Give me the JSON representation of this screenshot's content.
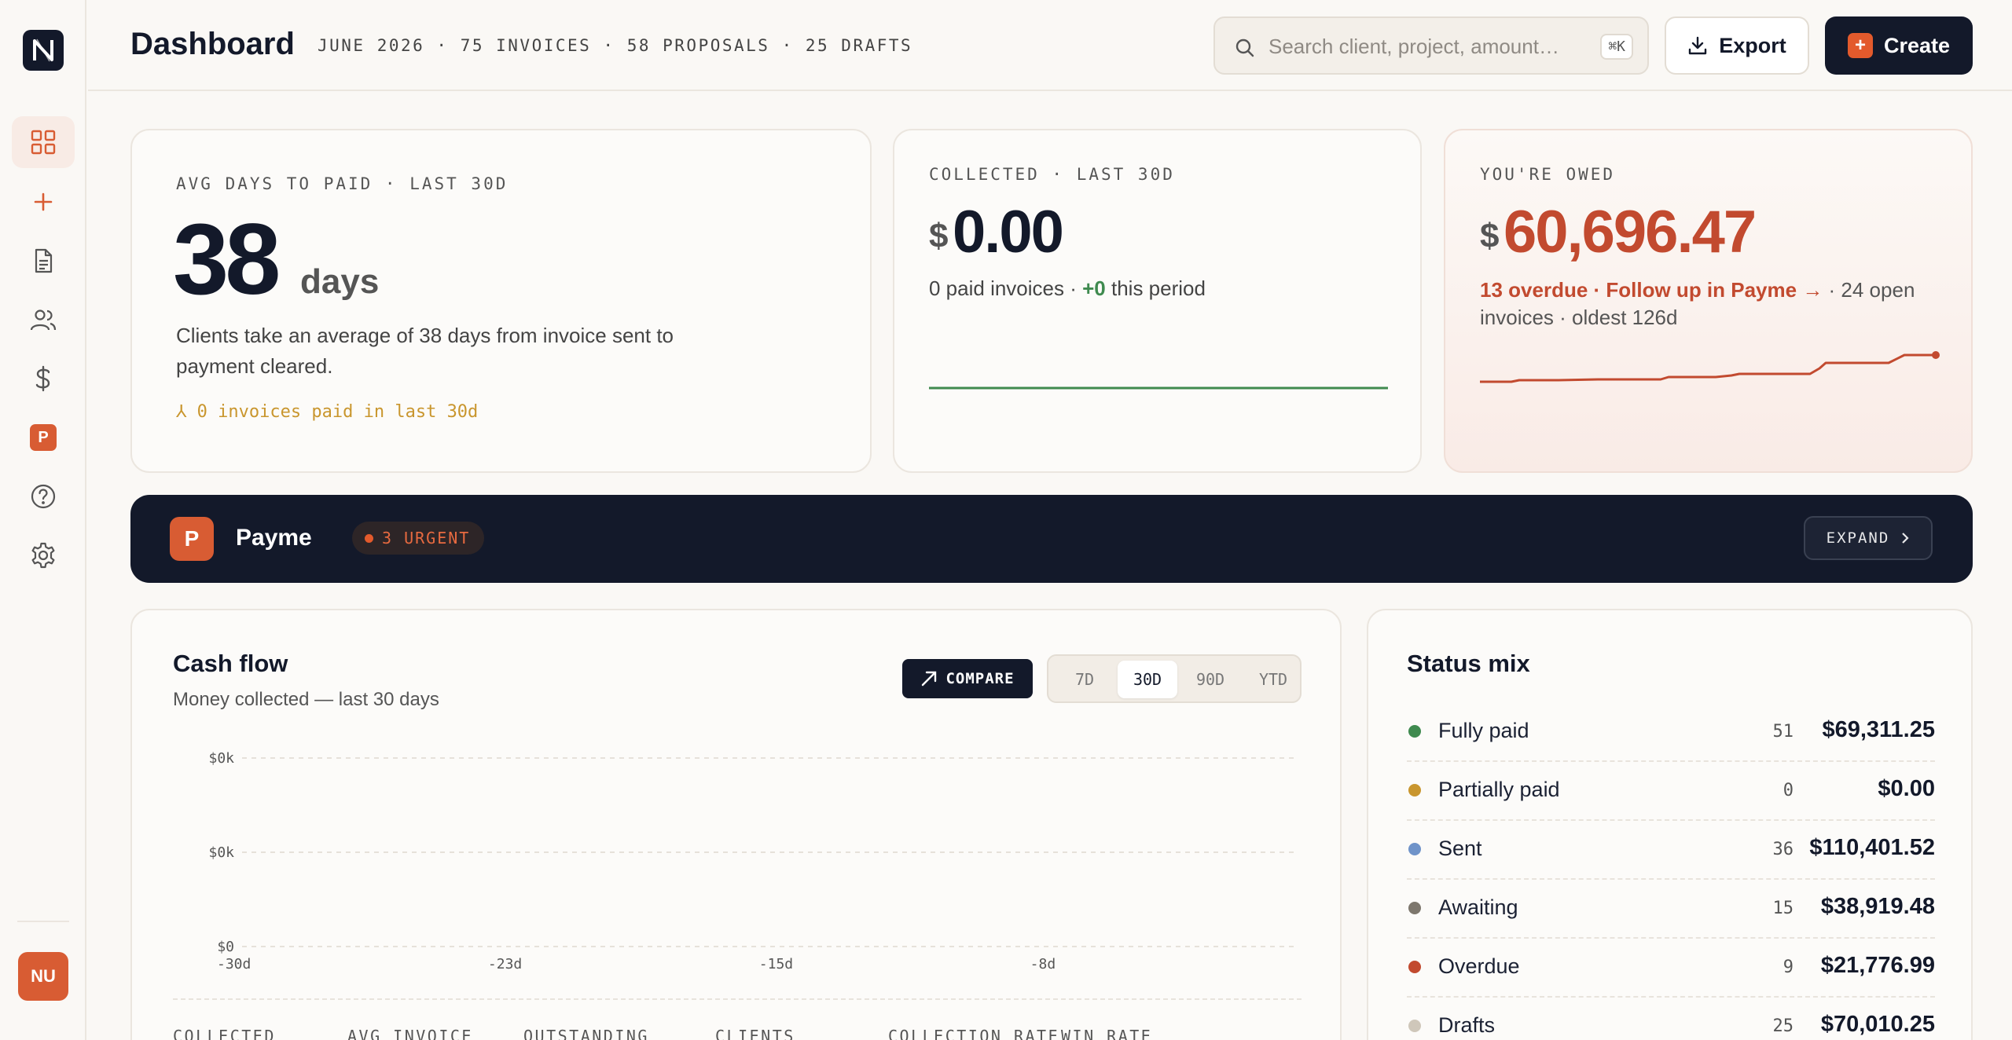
{
  "app": {
    "logo_letter": "N",
    "avatar_initials": "NU",
    "sidebar_p_badge": "P"
  },
  "header": {
    "title": "Dashboard",
    "subtitle": "JUNE 2026 · 75 INVOICES · 58 PROPOSALS · 25 DRAFTS",
    "search_placeholder": "Search client, project, amount…",
    "search_shortcut": "⌘K",
    "export_label": "Export",
    "create_label": "Create"
  },
  "cards": {
    "avg_days": {
      "label": "AVG DAYS TO PAID · LAST 30D",
      "value": "38",
      "unit": "days",
      "description": "Clients take an average of 38 days from invoice sent to payment cleared.",
      "note": "⅄ 0 invoices paid in last 30d"
    },
    "collected": {
      "label": "COLLECTED · LAST 30D",
      "currency": "$",
      "value": "0.00",
      "detail_prefix": "0 paid invoices · ",
      "detail_delta": "+0",
      "detail_suffix": " this period"
    },
    "owed": {
      "label": "YOU'RE OWED",
      "currency": "$",
      "value": "60,696.47",
      "alert": "13 overdue · Follow up in Payme →",
      "detail": " · 24 open invoices · oldest 126d"
    }
  },
  "payme": {
    "badge_letter": "P",
    "name": "Payme",
    "urgent_label": "3 URGENT",
    "expand_label": "EXPAND"
  },
  "cashflow": {
    "title": "Cash flow",
    "subtitle": "Money collected — last 30 days",
    "compare_label": "COMPARE",
    "ranges": [
      "7D",
      "30D",
      "90D",
      "YTD"
    ],
    "active_range": "30D",
    "footer_labels": [
      "COLLECTED",
      "AVG INVOICE",
      "OUTSTANDING",
      "CLIENTS",
      "COLLECTION RATE",
      "WIN RATE"
    ]
  },
  "chart_data": {
    "type": "line",
    "title": "Cash flow",
    "subtitle": "Money collected — last 30 days",
    "x_tick_labels": [
      "-30d",
      "-23d",
      "-15d",
      "-8d"
    ],
    "y_tick_labels": [
      "$0k",
      "$0k",
      "$0"
    ],
    "series": [
      {
        "values": [
          0,
          0,
          0,
          0
        ]
      }
    ],
    "grid": true
  },
  "status_mix": {
    "title": "Status mix",
    "rows": [
      {
        "label": "Fully paid",
        "count": "51",
        "amount": "$69,311.25",
        "color": "#3f8a4f"
      },
      {
        "label": "Partially paid",
        "count": "0",
        "amount": "$0.00",
        "color": "#c9962e"
      },
      {
        "label": "Sent",
        "count": "36",
        "amount": "$110,401.52",
        "color": "#6f93c9"
      },
      {
        "label": "Awaiting",
        "count": "15",
        "amount": "$38,919.48",
        "color": "#7d776d"
      },
      {
        "label": "Overdue",
        "count": "9",
        "amount": "$21,776.99",
        "color": "#c24a2f"
      },
      {
        "label": "Drafts",
        "count": "25",
        "amount": "$70,010.25",
        "color": "#cfc7ba"
      }
    ]
  },
  "colors": {
    "accent": "#d85c33",
    "dark": "#13192a",
    "green": "#3f8a4f",
    "red": "#c24a2f",
    "gold": "#c9962e"
  }
}
